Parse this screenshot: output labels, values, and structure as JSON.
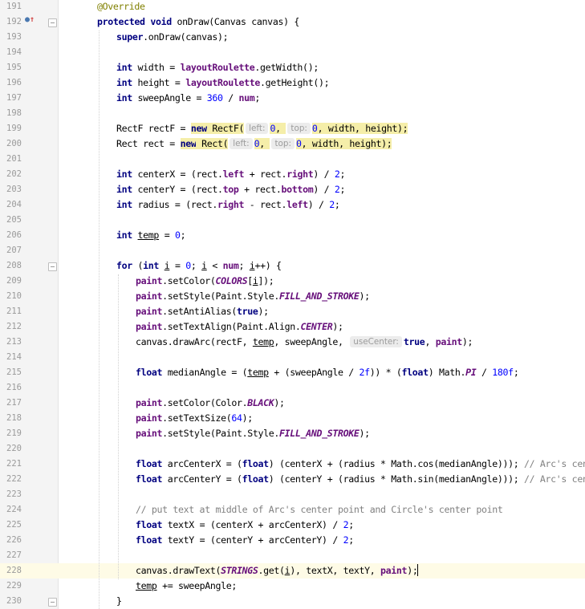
{
  "editor": {
    "lines": [
      {
        "n": "191",
        "indent": 0,
        "tokens": [
          {
            "t": "@Override",
            "c": "ann"
          }
        ]
      },
      {
        "n": "192",
        "indent": 0,
        "tokens": [
          {
            "t": "protected",
            "c": "kw"
          },
          {
            "t": " "
          },
          {
            "t": "void",
            "c": "kw"
          },
          {
            "t": " onDraw(Canvas canvas) {"
          }
        ]
      },
      {
        "n": "193",
        "indent": 1,
        "tokens": [
          {
            "t": "super",
            "c": "kw"
          },
          {
            "t": ".onDraw(canvas);"
          }
        ]
      },
      {
        "n": "194",
        "indent": 0,
        "tokens": []
      },
      {
        "n": "195",
        "indent": 1,
        "tokens": [
          {
            "t": "int",
            "c": "kw"
          },
          {
            "t": " width = "
          },
          {
            "t": "layoutRoulette",
            "c": "fld"
          },
          {
            "t": ".getWidth();"
          }
        ]
      },
      {
        "n": "196",
        "indent": 1,
        "tokens": [
          {
            "t": "int",
            "c": "kw"
          },
          {
            "t": " height = "
          },
          {
            "t": "layoutRoulette",
            "c": "fld"
          },
          {
            "t": ".getHeight();"
          }
        ]
      },
      {
        "n": "197",
        "indent": 1,
        "tokens": [
          {
            "t": "int",
            "c": "kw"
          },
          {
            "t": " sweepAngle = "
          },
          {
            "t": "360",
            "c": "num"
          },
          {
            "t": " / "
          },
          {
            "t": "num",
            "c": "fld"
          },
          {
            "t": ";"
          }
        ]
      },
      {
        "n": "198",
        "indent": 0,
        "tokens": []
      },
      {
        "n": "199",
        "indent": 1,
        "tokens": [
          {
            "t": "RectF rectF = "
          },
          {
            "t": "new",
            "c": "kw hl"
          },
          {
            "t": " RectF(",
            "c": "hl"
          },
          {
            "t": "left:",
            "c": "hint"
          },
          {
            "t": "0",
            "c": "num hl"
          },
          {
            "t": ", ",
            "c": "hl"
          },
          {
            "t": "top:",
            "c": "hint"
          },
          {
            "t": "0",
            "c": "num hl"
          },
          {
            "t": ", width, height);",
            "c": "hl"
          }
        ]
      },
      {
        "n": "200",
        "indent": 1,
        "tokens": [
          {
            "t": "Rect rect = "
          },
          {
            "t": "new",
            "c": "kw hl"
          },
          {
            "t": " Rect(",
            "c": "hl"
          },
          {
            "t": "left:",
            "c": "hint"
          },
          {
            "t": "0",
            "c": "num hl"
          },
          {
            "t": ", ",
            "c": "hl"
          },
          {
            "t": "top:",
            "c": "hint"
          },
          {
            "t": "0",
            "c": "num hl"
          },
          {
            "t": ", width, height);",
            "c": "hl"
          }
        ]
      },
      {
        "n": "201",
        "indent": 0,
        "tokens": []
      },
      {
        "n": "202",
        "indent": 1,
        "tokens": [
          {
            "t": "int",
            "c": "kw"
          },
          {
            "t": " centerX = (rect."
          },
          {
            "t": "left",
            "c": "fld"
          },
          {
            "t": " + rect."
          },
          {
            "t": "right",
            "c": "fld"
          },
          {
            "t": ") / "
          },
          {
            "t": "2",
            "c": "num"
          },
          {
            "t": ";"
          }
        ]
      },
      {
        "n": "203",
        "indent": 1,
        "tokens": [
          {
            "t": "int",
            "c": "kw"
          },
          {
            "t": " centerY = (rect."
          },
          {
            "t": "top",
            "c": "fld"
          },
          {
            "t": " + rect."
          },
          {
            "t": "bottom",
            "c": "fld"
          },
          {
            "t": ") / "
          },
          {
            "t": "2",
            "c": "num"
          },
          {
            "t": ";"
          }
        ]
      },
      {
        "n": "204",
        "indent": 1,
        "tokens": [
          {
            "t": "int",
            "c": "kw"
          },
          {
            "t": " radius = (rect."
          },
          {
            "t": "right",
            "c": "fld"
          },
          {
            "t": " - rect."
          },
          {
            "t": "left",
            "c": "fld"
          },
          {
            "t": ") / "
          },
          {
            "t": "2",
            "c": "num"
          },
          {
            "t": ";"
          }
        ]
      },
      {
        "n": "205",
        "indent": 0,
        "tokens": []
      },
      {
        "n": "206",
        "indent": 1,
        "tokens": [
          {
            "t": "int",
            "c": "kw"
          },
          {
            "t": " "
          },
          {
            "t": "temp",
            "c": "und"
          },
          {
            "t": " = "
          },
          {
            "t": "0",
            "c": "num"
          },
          {
            "t": ";"
          }
        ]
      },
      {
        "n": "207",
        "indent": 0,
        "tokens": []
      },
      {
        "n": "208",
        "indent": 1,
        "tokens": [
          {
            "t": "for",
            "c": "kw"
          },
          {
            "t": " ("
          },
          {
            "t": "int",
            "c": "kw"
          },
          {
            "t": " "
          },
          {
            "t": "i",
            "c": "und"
          },
          {
            "t": " = "
          },
          {
            "t": "0",
            "c": "num"
          },
          {
            "t": "; "
          },
          {
            "t": "i",
            "c": "und"
          },
          {
            "t": " < "
          },
          {
            "t": "num",
            "c": "fld"
          },
          {
            "t": "; "
          },
          {
            "t": "i",
            "c": "und"
          },
          {
            "t": "++) {"
          }
        ]
      },
      {
        "n": "209",
        "indent": 2,
        "tokens": [
          {
            "t": "paint",
            "c": "fld"
          },
          {
            "t": ".setColor("
          },
          {
            "t": "COLORS",
            "c": "stat"
          },
          {
            "t": "["
          },
          {
            "t": "i",
            "c": "und"
          },
          {
            "t": "]);"
          }
        ]
      },
      {
        "n": "210",
        "indent": 2,
        "tokens": [
          {
            "t": "paint",
            "c": "fld"
          },
          {
            "t": ".setStyle(Paint.Style."
          },
          {
            "t": "FILL_AND_STROKE",
            "c": "stat"
          },
          {
            "t": ");"
          }
        ]
      },
      {
        "n": "211",
        "indent": 2,
        "tokens": [
          {
            "t": "paint",
            "c": "fld"
          },
          {
            "t": ".setAntiAlias("
          },
          {
            "t": "true",
            "c": "kw"
          },
          {
            "t": ");"
          }
        ]
      },
      {
        "n": "212",
        "indent": 2,
        "tokens": [
          {
            "t": "paint",
            "c": "fld"
          },
          {
            "t": ".setTextAlign(Paint.Align."
          },
          {
            "t": "CENTER",
            "c": "stat"
          },
          {
            "t": ");"
          }
        ]
      },
      {
        "n": "213",
        "indent": 2,
        "tokens": [
          {
            "t": "canvas.drawArc(rectF, "
          },
          {
            "t": "temp",
            "c": "und"
          },
          {
            "t": ", sweepAngle, "
          },
          {
            "t": "useCenter:",
            "c": "hint"
          },
          {
            "t": "true",
            "c": "kw"
          },
          {
            "t": ", "
          },
          {
            "t": "paint",
            "c": "fld"
          },
          {
            "t": ");"
          }
        ]
      },
      {
        "n": "214",
        "indent": 0,
        "tokens": []
      },
      {
        "n": "215",
        "indent": 2,
        "tokens": [
          {
            "t": "float",
            "c": "kw"
          },
          {
            "t": " medianAngle = ("
          },
          {
            "t": "temp",
            "c": "und"
          },
          {
            "t": " + (sweepAngle / "
          },
          {
            "t": "2f",
            "c": "num"
          },
          {
            "t": ")) * ("
          },
          {
            "t": "float",
            "c": "kw"
          },
          {
            "t": ") Math."
          },
          {
            "t": "PI",
            "c": "stat"
          },
          {
            "t": " / "
          },
          {
            "t": "180f",
            "c": "num"
          },
          {
            "t": ";"
          }
        ]
      },
      {
        "n": "216",
        "indent": 0,
        "tokens": []
      },
      {
        "n": "217",
        "indent": 2,
        "tokens": [
          {
            "t": "paint",
            "c": "fld"
          },
          {
            "t": ".setColor(Color."
          },
          {
            "t": "BLACK",
            "c": "stat"
          },
          {
            "t": ");"
          }
        ]
      },
      {
        "n": "218",
        "indent": 2,
        "tokens": [
          {
            "t": "paint",
            "c": "fld"
          },
          {
            "t": ".setTextSize("
          },
          {
            "t": "64",
            "c": "num"
          },
          {
            "t": ");"
          }
        ]
      },
      {
        "n": "219",
        "indent": 2,
        "tokens": [
          {
            "t": "paint",
            "c": "fld"
          },
          {
            "t": ".setStyle(Paint.Style."
          },
          {
            "t": "FILL_AND_STROKE",
            "c": "stat"
          },
          {
            "t": ");"
          }
        ]
      },
      {
        "n": "220",
        "indent": 0,
        "tokens": []
      },
      {
        "n": "221",
        "indent": 2,
        "tokens": [
          {
            "t": "float",
            "c": "kw"
          },
          {
            "t": " arcCenterX = ("
          },
          {
            "t": "float",
            "c": "kw"
          },
          {
            "t": ") (centerX + (radius * Math.cos(medianAngle))); "
          },
          {
            "t": "// Arc's center X",
            "c": "cmt"
          }
        ]
      },
      {
        "n": "222",
        "indent": 2,
        "tokens": [
          {
            "t": "float",
            "c": "kw"
          },
          {
            "t": " arcCenterY = ("
          },
          {
            "t": "float",
            "c": "kw"
          },
          {
            "t": ") (centerY + (radius * Math.sin(medianAngle))); "
          },
          {
            "t": "// Arc's center Y",
            "c": "cmt"
          }
        ]
      },
      {
        "n": "223",
        "indent": 0,
        "tokens": []
      },
      {
        "n": "224",
        "indent": 2,
        "tokens": [
          {
            "t": "// put text at middle of Arc's center point and Circle's center point",
            "c": "cmt"
          }
        ]
      },
      {
        "n": "225",
        "indent": 2,
        "tokens": [
          {
            "t": "float",
            "c": "kw"
          },
          {
            "t": " textX = (centerX + arcCenterX) / "
          },
          {
            "t": "2",
            "c": "num"
          },
          {
            "t": ";"
          }
        ]
      },
      {
        "n": "226",
        "indent": 2,
        "tokens": [
          {
            "t": "float",
            "c": "kw"
          },
          {
            "t": " textY = (centerY + arcCenterY) / "
          },
          {
            "t": "2",
            "c": "num"
          },
          {
            "t": ";"
          }
        ]
      },
      {
        "n": "227",
        "indent": 0,
        "tokens": []
      },
      {
        "n": "228",
        "indent": 2,
        "current": true,
        "tokens": [
          {
            "t": "canvas.drawText("
          },
          {
            "t": "STRINGS",
            "c": "stat"
          },
          {
            "t": ".get("
          },
          {
            "t": "i",
            "c": "und"
          },
          {
            "t": "), textX, textY, "
          },
          {
            "t": "paint",
            "c": "fld"
          },
          {
            "t": ");"
          },
          {
            "t": "",
            "c": "caret"
          }
        ]
      },
      {
        "n": "229",
        "indent": 2,
        "tokens": [
          {
            "t": "temp",
            "c": "und"
          },
          {
            "t": " += sweepAngle;"
          }
        ]
      },
      {
        "n": "230",
        "indent": 1,
        "tokens": [
          {
            "t": "}"
          }
        ]
      }
    ],
    "gutter_icons": {
      "override": "overriding-method-icon"
    },
    "colors": {
      "keyword": "#000080",
      "field": "#660e7a",
      "number": "#0000ff",
      "annotation": "#808000",
      "comment": "#808080",
      "current_line": "#fefbe6",
      "highlight": "#f5eea9"
    }
  }
}
